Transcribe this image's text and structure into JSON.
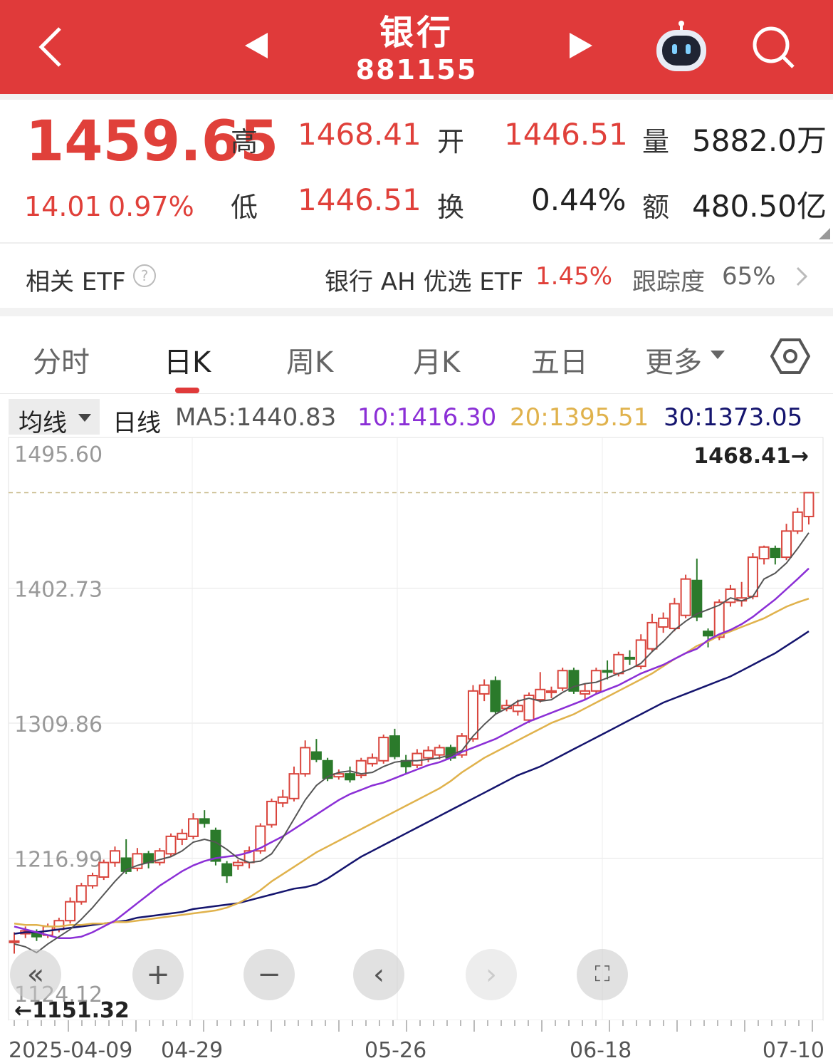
{
  "header": {
    "title": "银行",
    "code": "881155"
  },
  "quote": {
    "price": "1459.65",
    "change": "14.01",
    "change_pct": "0.97%",
    "high_label": "高",
    "high": "1468.41",
    "low_label": "低",
    "low": "1446.51",
    "open_label": "开",
    "open": "1446.51",
    "turnover_label": "换",
    "turnover": "0.44%",
    "volume_label": "量",
    "volume": "5882.0万",
    "amount_label": "额",
    "amount": "480.50亿"
  },
  "etf": {
    "label": "相关 ETF",
    "name": "银行 AH 优选 ETF",
    "change": "1.45%",
    "track_label": "跟踪度",
    "track": "65%"
  },
  "tabs": [
    "分时",
    "日K",
    "周K",
    "月K",
    "五日",
    "更多"
  ],
  "active_tab": 1,
  "ma_bar": {
    "selector": "均线",
    "period": "日线",
    "ma5": "MA5:1440.83",
    "ma10": "10:1416.30",
    "ma20": "20:1395.51",
    "ma30": "30:1373.05"
  },
  "colors": {
    "header": "#e03a3a",
    "up": "#d9453d",
    "down": "#2b7a2b",
    "ma5": "#555555",
    "ma10": "#8b2fd6",
    "ma20": "#e0b24c",
    "ma30": "#14146e"
  },
  "chart_data": {
    "type": "candlestick",
    "y_ticks": [
      "1495.60",
      "1402.73",
      "1309.86",
      "1216.99",
      "1124.12"
    ],
    "ylim": [
      1124.12,
      1495.6
    ],
    "max_label": "1468.41→",
    "min_label": "←1151.32",
    "x_ticks": [
      "2025-04-09",
      "04-29",
      "05-26",
      "06-18",
      "07-10"
    ],
    "candles": [
      [
        1160,
        1160,
        1151.32,
        1166
      ],
      [
        1165,
        1167,
        1162,
        1170
      ],
      [
        1166,
        1163,
        1160,
        1168
      ],
      [
        1164,
        1170,
        1162,
        1172
      ],
      [
        1168,
        1174,
        1166,
        1176
      ],
      [
        1174,
        1187,
        1172,
        1190
      ],
      [
        1187,
        1198,
        1185,
        1200
      ],
      [
        1198,
        1205,
        1196,
        1207
      ],
      [
        1204,
        1214,
        1202,
        1216
      ],
      [
        1214,
        1222,
        1211,
        1225
      ],
      [
        1217,
        1208,
        1206,
        1230
      ],
      [
        1210,
        1220,
        1208,
        1224
      ],
      [
        1220,
        1214,
        1210,
        1222
      ],
      [
        1214,
        1222,
        1212,
        1224
      ],
      [
        1220,
        1232,
        1218,
        1234
      ],
      [
        1230,
        1234,
        1226,
        1237
      ],
      [
        1232,
        1244,
        1230,
        1248
      ],
      [
        1244,
        1241,
        1238,
        1250
      ],
      [
        1236,
        1215,
        1212,
        1238
      ],
      [
        1213,
        1205,
        1200,
        1215
      ],
      [
        1212,
        1214,
        1209,
        1216
      ],
      [
        1214,
        1222,
        1210,
        1225
      ],
      [
        1222,
        1239,
        1220,
        1241
      ],
      [
        1240,
        1256,
        1238,
        1258
      ],
      [
        1255,
        1259,
        1252,
        1264
      ],
      [
        1258,
        1275,
        1256,
        1280
      ],
      [
        1275,
        1293,
        1273,
        1298
      ],
      [
        1290,
        1285,
        1283,
        1299
      ],
      [
        1284,
        1272,
        1270,
        1286
      ],
      [
        1273,
        1275,
        1271,
        1278
      ],
      [
        1275,
        1271,
        1269,
        1280
      ],
      [
        1274,
        1284,
        1272,
        1286
      ],
      [
        1282,
        1286,
        1280,
        1289
      ],
      [
        1284,
        1300,
        1282,
        1302
      ],
      [
        1301,
        1287,
        1285,
        1306
      ],
      [
        1284,
        1280,
        1275,
        1288
      ],
      [
        1281,
        1289,
        1279,
        1292
      ],
      [
        1286,
        1291,
        1283,
        1294
      ],
      [
        1288,
        1293,
        1285,
        1295
      ],
      [
        1293,
        1286,
        1284,
        1295
      ],
      [
        1288,
        1301,
        1286,
        1303
      ],
      [
        1299,
        1332,
        1297,
        1336
      ],
      [
        1330,
        1336,
        1325,
        1340
      ],
      [
        1339,
        1318,
        1316,
        1342
      ],
      [
        1320,
        1322,
        1318,
        1326
      ],
      [
        1318,
        1322,
        1315,
        1326
      ],
      [
        1312,
        1329,
        1310,
        1331
      ],
      [
        1326,
        1333,
        1324,
        1345
      ],
      [
        1331,
        1332,
        1327,
        1335
      ],
      [
        1334,
        1346,
        1332,
        1348
      ],
      [
        1346,
        1332,
        1330,
        1348
      ],
      [
        1330,
        1332,
        1326,
        1337
      ],
      [
        1332,
        1346,
        1330,
        1348
      ],
      [
        1346,
        1345,
        1340,
        1353
      ],
      [
        1344,
        1357,
        1342,
        1359
      ],
      [
        1355,
        1354,
        1350,
        1360
      ],
      [
        1349,
        1367,
        1347,
        1371
      ],
      [
        1361,
        1379,
        1359,
        1385
      ],
      [
        1376,
        1382,
        1372,
        1386
      ],
      [
        1375,
        1392,
        1373,
        1396
      ],
      [
        1384,
        1409,
        1382,
        1412
      ],
      [
        1408,
        1383,
        1380,
        1423
      ],
      [
        1373,
        1370,
        1362,
        1375
      ],
      [
        1369,
        1393,
        1367,
        1395
      ],
      [
        1393,
        1402,
        1390,
        1405
      ],
      [
        1394,
        1396,
        1390,
        1407
      ],
      [
        1397,
        1424,
        1395,
        1427
      ],
      [
        1423,
        1431,
        1419,
        1432
      ],
      [
        1430,
        1424,
        1419,
        1432
      ],
      [
        1424,
        1442,
        1422,
        1447
      ],
      [
        1442,
        1455,
        1440,
        1458
      ],
      [
        1452,
        1468.41,
        1446.51,
        1468.41
      ]
    ],
    "ma": {
      "ma5": [
        1158,
        1156,
        1152,
        1158,
        1163,
        1168,
        1175,
        1183,
        1192,
        1201,
        1209,
        1212,
        1214,
        1216,
        1218,
        1222,
        1228,
        1230,
        1228,
        1223,
        1217,
        1214,
        1215,
        1220,
        1231,
        1244,
        1257,
        1267,
        1273,
        1276,
        1277,
        1275,
        1276,
        1280,
        1283,
        1284,
        1284,
        1285,
        1286,
        1288,
        1291,
        1301,
        1309,
        1316,
        1320,
        1325,
        1327,
        1325,
        1326,
        1331,
        1335,
        1337,
        1338,
        1341,
        1344,
        1347,
        1351,
        1359,
        1366,
        1374,
        1380,
        1385,
        1388,
        1391,
        1396,
        1394,
        1397,
        1409,
        1413,
        1420,
        1430,
        1440.83
      ],
      "ma10": [
        1170,
        1168,
        1166,
        1164,
        1162,
        1162,
        1163,
        1166,
        1170,
        1174,
        1180,
        1186,
        1192,
        1198,
        1203,
        1208,
        1212,
        1215,
        1217,
        1218,
        1219,
        1221,
        1224,
        1228,
        1232,
        1237,
        1242,
        1247,
        1252,
        1257,
        1261,
        1264,
        1267,
        1269,
        1272,
        1275,
        1278,
        1281,
        1283,
        1286,
        1290,
        1293,
        1296,
        1299,
        1303,
        1307,
        1311,
        1314,
        1317,
        1320,
        1323,
        1326,
        1330,
        1333,
        1336,
        1340,
        1344,
        1347,
        1350,
        1354,
        1358,
        1361,
        1367,
        1371,
        1374,
        1378,
        1383,
        1389,
        1395,
        1402,
        1409,
        1416.3
      ],
      "ma20": [
        1172,
        1171,
        1171,
        1170,
        1170,
        1171,
        1171,
        1172,
        1172,
        1173,
        1173,
        1174,
        1175,
        1176,
        1177,
        1178,
        1179,
        1180,
        1181,
        1183,
        1186,
        1190,
        1195,
        1201,
        1206,
        1211,
        1216,
        1221,
        1225,
        1229,
        1233,
        1237,
        1241,
        1245,
        1249,
        1253,
        1257,
        1261,
        1265,
        1270,
        1276,
        1281,
        1286,
        1290,
        1294,
        1298,
        1302,
        1306,
        1310,
        1313,
        1316,
        1320,
        1324,
        1328,
        1332,
        1336,
        1340,
        1344,
        1349,
        1354,
        1358,
        1363,
        1366,
        1370,
        1373,
        1376,
        1379,
        1382,
        1386,
        1390,
        1393,
        1395.51
      ],
      "ma30": [
        1165,
        1166,
        1166,
        1167,
        1168,
        1169,
        1170,
        1171,
        1172,
        1173,
        1174,
        1176,
        1177,
        1178,
        1179,
        1180,
        1182,
        1183,
        1184,
        1185,
        1186,
        1188,
        1190,
        1192,
        1194,
        1196,
        1197,
        1199,
        1203,
        1208,
        1213,
        1218,
        1222,
        1226,
        1230,
        1234,
        1238,
        1242,
        1246,
        1250,
        1254,
        1258,
        1262,
        1266,
        1270,
        1274,
        1277,
        1280,
        1284,
        1288,
        1292,
        1296,
        1300,
        1304,
        1308,
        1312,
        1316,
        1320,
        1324,
        1327,
        1330,
        1333,
        1336,
        1339,
        1342,
        1346,
        1350,
        1354,
        1358,
        1363,
        1368,
        1373.05
      ]
    }
  }
}
